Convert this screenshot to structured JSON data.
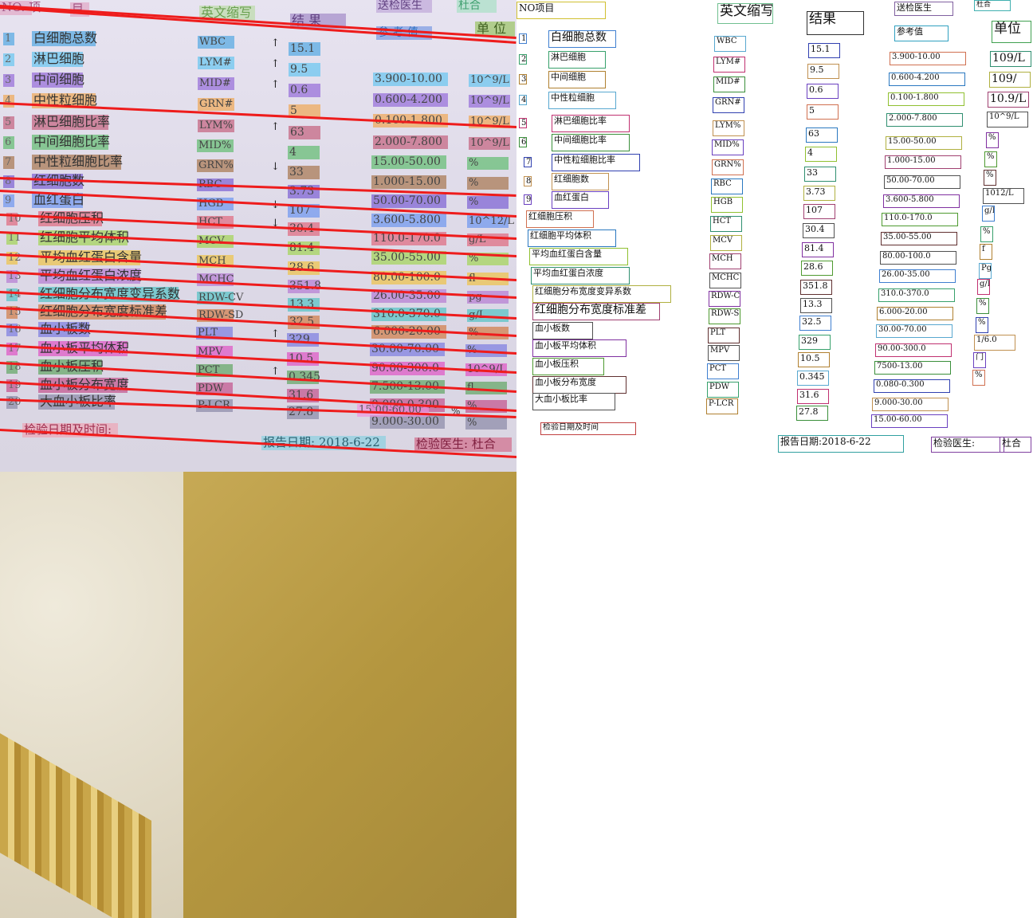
{
  "photo": {
    "header": {
      "no": "NO. 项",
      "item": "目",
      "abbr": "英文缩写",
      "result": "结  果",
      "ref": "参 考 值",
      "doctor": "送检医生",
      "doctor_name": "杜合",
      "unit": "单  位"
    },
    "rows": [
      {
        "no": "1",
        "name": "白细胞总数",
        "abbr": "WBC",
        "flag": "↑",
        "result": "15.1",
        "ref": "",
        "unit": ""
      },
      {
        "no": "2",
        "name": "淋巴细胞",
        "abbr": "LYM#",
        "flag": "↑",
        "result": "9.5",
        "ref": "3.900-10.00",
        "unit": "10^9/L"
      },
      {
        "no": "3",
        "name": "中间细胞",
        "abbr": "MID#",
        "flag": "↑",
        "result": "0.6",
        "ref": "0.600-4.200",
        "unit": "10^9/L"
      },
      {
        "no": "4",
        "name": "中性粒细胞",
        "abbr": "GRN#",
        "flag": "",
        "result": "5",
        "ref": "0.100-1.800",
        "unit": "10^9/L"
      },
      {
        "no": "5",
        "name": "淋巴细胞比率",
        "abbr": "LYM%",
        "flag": "↑",
        "result": "63",
        "ref": "2.000-7.800",
        "unit": "10^9/L"
      },
      {
        "no": "6",
        "name": "中间细胞比率",
        "abbr": "MID%",
        "flag": "",
        "result": "4",
        "ref": "15.00-50.00",
        "unit": "%"
      },
      {
        "no": "7",
        "name": "中性粒细胞比率",
        "abbr": "GRN%",
        "flag": "↓",
        "result": "33",
        "ref": "1.000-15.00",
        "unit": "%"
      },
      {
        "no": "8",
        "name": "红细胞数",
        "abbr": "RBC",
        "flag": "",
        "result": "3.73",
        "ref": "50.00-70.00",
        "unit": "%"
      },
      {
        "no": "9",
        "name": "血红蛋白",
        "abbr": "HGB",
        "flag": "↓",
        "result": "107",
        "ref": "3.600-5.800",
        "unit": "10^12/L"
      },
      {
        "no": "10",
        "name": "红细胞压积",
        "abbr": "HCT",
        "flag": "↓",
        "result": "30.4",
        "ref": "110.0-170.0",
        "unit": "g/L"
      },
      {
        "no": "11",
        "name": "红细胞平均体积",
        "abbr": "MCV",
        "flag": "",
        "result": "81.4",
        "ref": "35.00-55.00",
        "unit": "%"
      },
      {
        "no": "12",
        "name": "平均血红蛋白含量",
        "abbr": "MCH",
        "flag": "",
        "result": "28.6",
        "ref": "80.00-100.0",
        "unit": "fl"
      },
      {
        "no": "13",
        "name": "平均血红蛋白浓度",
        "abbr": "MCHC",
        "flag": "",
        "result": "351.8",
        "ref": "26.00-35.00",
        "unit": "pg"
      },
      {
        "no": "14",
        "name": "红细胞分布宽度变异系数",
        "abbr": "RDW-CV",
        "flag": "",
        "result": "13.3",
        "ref": "310.0-370.0",
        "unit": "g/L"
      },
      {
        "no": "15",
        "name": "红细胞分布宽度标准差",
        "abbr": "RDW-SD",
        "flag": "",
        "result": "32.5",
        "ref": "6.000-20.00",
        "unit": "%"
      },
      {
        "no": "16",
        "name": "血小板数",
        "abbr": "PLT",
        "flag": "↑",
        "result": "329",
        "ref": "30.00-70.00",
        "unit": "%"
      },
      {
        "no": "17",
        "name": "血小板平均体积",
        "abbr": "MPV",
        "flag": "",
        "result": "10.5",
        "ref": "90.00-300.0",
        "unit": "10^9/L"
      },
      {
        "no": "18",
        "name": "血小板压积",
        "abbr": "PCT",
        "flag": "↑",
        "result": "0.345",
        "ref": "7.500-13.00",
        "unit": "fl"
      },
      {
        "no": "19",
        "name": "血小板分布宽度",
        "abbr": "PDW",
        "flag": "",
        "result": "31.6",
        "ref": "0.080-0.300",
        "unit": "%"
      },
      {
        "no": "20",
        "name": "大血小板比率",
        "abbr": "P-LCR",
        "flag": "",
        "result": "27.8",
        "ref": "9.000-30.00",
        "unit": "%"
      }
    ],
    "extra_ref": "15.00-60.00",
    "extra_unit": "%",
    "footer": {
      "date_label": "检验日期及时间:",
      "report_date": "报告日期: 2018-6-22",
      "doctor": "检验医生: 杜合"
    }
  },
  "ocr": {
    "header": {
      "no": "NO项目",
      "abbr": "英文缩写",
      "result": "结果",
      "doctor": "送检医生",
      "doctor_name": "杜合",
      "ref": "参考值",
      "unit": "单位"
    },
    "nos": [
      "1",
      "2",
      "3",
      "4",
      "5",
      "6",
      "7",
      "8",
      "9",
      "10",
      "11",
      "12",
      "13",
      "14",
      "15",
      "16",
      "17",
      "18",
      "19",
      "20"
    ],
    "names": [
      "白细胞总数",
      "淋巴细胞",
      "中间细胞",
      "中性粒细胞",
      "淋巴细胞比率",
      "中间细胞比率",
      "中性粒细胞比率",
      "红细胞数",
      "血红蛋白",
      "红细胞压积",
      "红细胞平均体积",
      "平均血红蛋白含量",
      "平均血红蛋白浓度",
      "红细胞分布宽度变异系数",
      "红细胞分布宽度标准差",
      "血小板数",
      "血小板平均体积",
      "血小板压积",
      "血小板分布宽度",
      "大血小板比率"
    ],
    "abbrs": [
      "WBC",
      "LYM#",
      "MID#",
      "GRN#",
      "LYM%",
      "MID%",
      "GRN%",
      "RBC",
      "HGB",
      "HCT",
      "MCV",
      "MCH",
      "MCHC",
      "RDW-CV",
      "RDW-SD",
      "PLT",
      "MPV",
      "PCT",
      "PDW",
      "P-LCR"
    ],
    "results": [
      "15.1",
      "9.5",
      "0.6",
      "5",
      "63",
      "4",
      "33",
      "3.73",
      "107",
      "30.4",
      "81.4",
      "28.6",
      "351.8",
      "13.3",
      "32.5",
      "329",
      "10.5",
      "0.345",
      "31.6",
      "27.8"
    ],
    "refs": [
      "3.900-10.00",
      "0.600-4.200",
      "0.100-1.800",
      "2.000-7.800",
      "15.00-50.00",
      "1.000-15.00",
      "50.00-70.00",
      "3.600-5.800",
      "110.0-170.0",
      "35.00-55.00",
      "80.00-100.0",
      "26.00-35.00",
      "310.0-370.0",
      "6.000-20.00",
      "30.00-70.00",
      "90.00-300.0",
      "7500-13.00",
      "0.080-0.300",
      "9.000-30.00",
      "15.00-60.00"
    ],
    "units": [
      "109/L",
      "109/",
      "10.9/L",
      "10^9/L",
      "%",
      "%",
      "%",
      "1012/L",
      "g/L",
      "%",
      "f",
      "Pg",
      "g/L",
      "%",
      "%",
      "1/6.0",
      "门",
      "%"
    ],
    "footer": {
      "date_label": "检验日期及时间",
      "report_date": "报告日期:2018-6-22",
      "doctor": "检验医生:",
      "doctor_name": "杜合"
    }
  },
  "colors": {
    "redline": "#ee1c1c",
    "couch": "#b4963f",
    "paper": "#e2deec"
  }
}
